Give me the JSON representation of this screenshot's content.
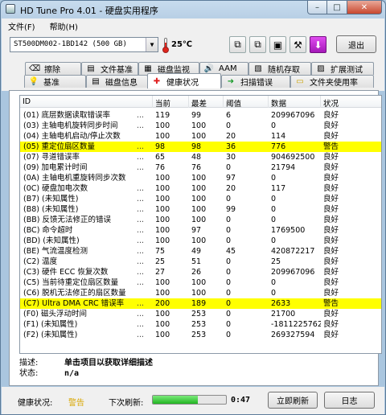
{
  "window": {
    "title": "HD Tune Pro 4.01 - 硬盘实用程序"
  },
  "window_controls": {
    "minimize": "–",
    "maximize": "□",
    "close": "✕"
  },
  "menu": [
    "文件(F)",
    "帮助(H)"
  ],
  "toolbar": {
    "drive": "ST500DM002-1BD142 (500 GB)",
    "drive_arrow": "▼",
    "temperature": "25℃",
    "exit": "退出",
    "buttons": [
      {
        "name": "copy-text-icon",
        "glyph": "⧉"
      },
      {
        "name": "copy-screenshot-icon",
        "glyph": "⧉"
      },
      {
        "name": "save-icon",
        "glyph": "▣"
      },
      {
        "name": "options-icon",
        "glyph": "⚒"
      },
      {
        "name": "download-icon",
        "glyph": "⬇"
      }
    ]
  },
  "tabs_row1": [
    {
      "label": "擦除",
      "icon": "⌫",
      "name": "tab-erase"
    },
    {
      "label": "文件基准",
      "icon": "▤",
      "name": "tab-file-benchmark"
    },
    {
      "label": "磁盘监视",
      "icon": "▦",
      "name": "tab-disk-monitor"
    },
    {
      "label": "AAM",
      "icon": "🔊",
      "name": "tab-aam"
    },
    {
      "label": "随机存取",
      "icon": "▧",
      "name": "tab-random-access"
    },
    {
      "label": "扩展测试",
      "icon": "▨",
      "name": "tab-extra-tests"
    }
  ],
  "tabs_row2": [
    {
      "label": "基准",
      "icon": "💡",
      "name": "tab-benchmark"
    },
    {
      "label": "磁盘信息",
      "icon": "▤",
      "name": "tab-disk-info"
    },
    {
      "label": "健康状况",
      "icon": "✚",
      "name": "tab-health"
    },
    {
      "label": "扫描错误",
      "icon": "➜",
      "name": "tab-error-scan"
    },
    {
      "label": "文件夹使用率",
      "icon": "▭",
      "name": "tab-folder-usage"
    }
  ],
  "table": {
    "headers": [
      "ID",
      "当前",
      "最差",
      "阈值",
      "数据",
      "状况"
    ],
    "rows": [
      {
        "id": "(01) 底层数据读取错误率",
        "dots": "...",
        "cur": "119",
        "worst": "99",
        "thr": "6",
        "data": "209967096",
        "status": "良好",
        "warn": false
      },
      {
        "id": "(03) 主轴电机旋转同步时间",
        "dots": "...",
        "cur": "100",
        "worst": "100",
        "thr": "0",
        "data": "0",
        "status": "良好",
        "warn": false
      },
      {
        "id": "(04) 主轴电机启动/停止次数",
        "dots": "",
        "cur": "100",
        "worst": "100",
        "thr": "20",
        "data": "114",
        "status": "良好",
        "warn": false
      },
      {
        "id": "(05) 重定位扇区数量",
        "dots": "...",
        "cur": "98",
        "worst": "98",
        "thr": "36",
        "data": "776",
        "status": "警告",
        "warn": true
      },
      {
        "id": "(07) 寻道错误率",
        "dots": "...",
        "cur": "65",
        "worst": "48",
        "thr": "30",
        "data": "904692500",
        "status": "良好",
        "warn": false
      },
      {
        "id": "(09) 加电累计时间",
        "dots": "...",
        "cur": "76",
        "worst": "76",
        "thr": "0",
        "data": "21794",
        "status": "良好",
        "warn": false
      },
      {
        "id": "(0A) 主轴电机重旋转同步次数",
        "dots": "",
        "cur": "100",
        "worst": "100",
        "thr": "97",
        "data": "0",
        "status": "良好",
        "warn": false
      },
      {
        "id": "(0C) 硬盘加电次数",
        "dots": "...",
        "cur": "100",
        "worst": "100",
        "thr": "20",
        "data": "117",
        "status": "良好",
        "warn": false
      },
      {
        "id": "(B7) (未知属性)",
        "dots": "...",
        "cur": "100",
        "worst": "100",
        "thr": "0",
        "data": "0",
        "status": "良好",
        "warn": false
      },
      {
        "id": "(B8) (未知属性)",
        "dots": "...",
        "cur": "100",
        "worst": "100",
        "thr": "99",
        "data": "0",
        "status": "良好",
        "warn": false
      },
      {
        "id": "(BB) 反馈无法修正的错误",
        "dots": "...",
        "cur": "100",
        "worst": "100",
        "thr": "0",
        "data": "0",
        "status": "良好",
        "warn": false
      },
      {
        "id": "(BC) 命令超时",
        "dots": "...",
        "cur": "100",
        "worst": "97",
        "thr": "0",
        "data": "1769500",
        "status": "良好",
        "warn": false
      },
      {
        "id": "(BD) (未知属性)",
        "dots": "...",
        "cur": "100",
        "worst": "100",
        "thr": "0",
        "data": "0",
        "status": "良好",
        "warn": false
      },
      {
        "id": "(BE) 气流温度检测",
        "dots": "...",
        "cur": "75",
        "worst": "49",
        "thr": "45",
        "data": "420872217",
        "status": "良好",
        "warn": false
      },
      {
        "id": "(C2) 温度",
        "dots": "...",
        "cur": "25",
        "worst": "51",
        "thr": "0",
        "data": "25",
        "status": "良好",
        "warn": false
      },
      {
        "id": "(C3) 硬件 ECC 恢复次数",
        "dots": "...",
        "cur": "27",
        "worst": "26",
        "thr": "0",
        "data": "209967096",
        "status": "良好",
        "warn": false
      },
      {
        "id": "(C5) 当前待重定位扇区数量",
        "dots": "...",
        "cur": "100",
        "worst": "100",
        "thr": "0",
        "data": "0",
        "status": "良好",
        "warn": false
      },
      {
        "id": "(C6) 脱机无法修正的扇区数量",
        "dots": "",
        "cur": "100",
        "worst": "100",
        "thr": "0",
        "data": "0",
        "status": "良好",
        "warn": false
      },
      {
        "id": "(C7) Ultra DMA CRC 错误率",
        "dots": "...",
        "cur": "200",
        "worst": "189",
        "thr": "0",
        "data": "2633",
        "status": "警告",
        "warn": true
      },
      {
        "id": "(F0) 磁头浮动时间",
        "dots": "...",
        "cur": "100",
        "worst": "253",
        "thr": "0",
        "data": "21700",
        "status": "良好",
        "warn": false
      },
      {
        "id": "(F1) (未知属性)",
        "dots": "...",
        "cur": "100",
        "worst": "253",
        "thr": "0",
        "data": "-1811225762",
        "status": "良好",
        "warn": false
      },
      {
        "id": "(F2) (未知属性)",
        "dots": "...",
        "cur": "100",
        "worst": "253",
        "thr": "0",
        "data": "269327594",
        "status": "良好",
        "warn": false
      }
    ]
  },
  "description": {
    "desc_label": "描述:",
    "desc_value": "单击项目以获取详细描述",
    "state_label": "状态:",
    "state_value": "n/a"
  },
  "status": {
    "health_label": "健康状况:",
    "health_value": "警告",
    "health_color": "#d9a600",
    "refresh_label": "下次刷新:",
    "refresh_progress": 0.62,
    "countdown": "0:47",
    "refresh_now": "立即刷新",
    "log": "日志"
  }
}
